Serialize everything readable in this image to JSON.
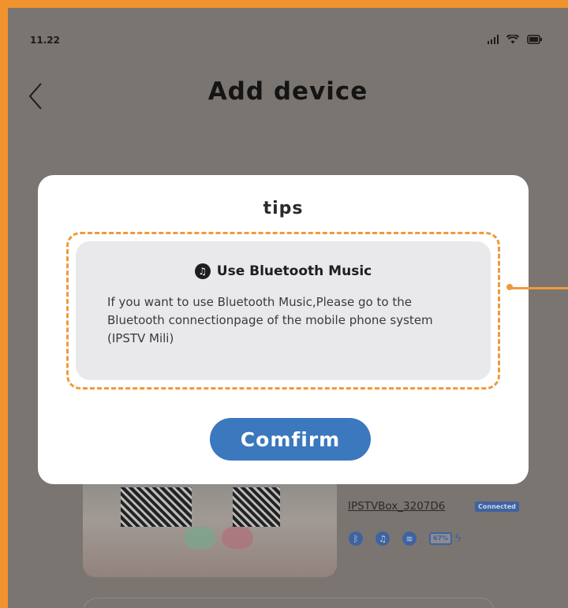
{
  "status_bar": {
    "time": "11.22",
    "icons": [
      "signal-icon",
      "wifi-icon",
      "battery-icon"
    ]
  },
  "header": {
    "title": "Add device",
    "back_icon": "chevron-left-icon"
  },
  "device": {
    "name": "IPSTVBox_3207D6",
    "status": "Connected",
    "battery": "67%",
    "icons": [
      "bluetooth-icon",
      "music-icon",
      "wifi-icon",
      "battery-icon",
      "charging-icon"
    ]
  },
  "dialog": {
    "title": "tips",
    "tip_heading": "Use Bluetooth Music",
    "tip_text": "If you want to use Bluetooth Music,Please go to the Bluetooth connectionpage of the mobile phone system (IPSTV Mili)",
    "confirm_label": "Comfirm"
  },
  "colors": {
    "accent_blue": "#3b78bd",
    "highlight_orange": "#ef9a3a",
    "overlay_gray": "#7a7571"
  }
}
